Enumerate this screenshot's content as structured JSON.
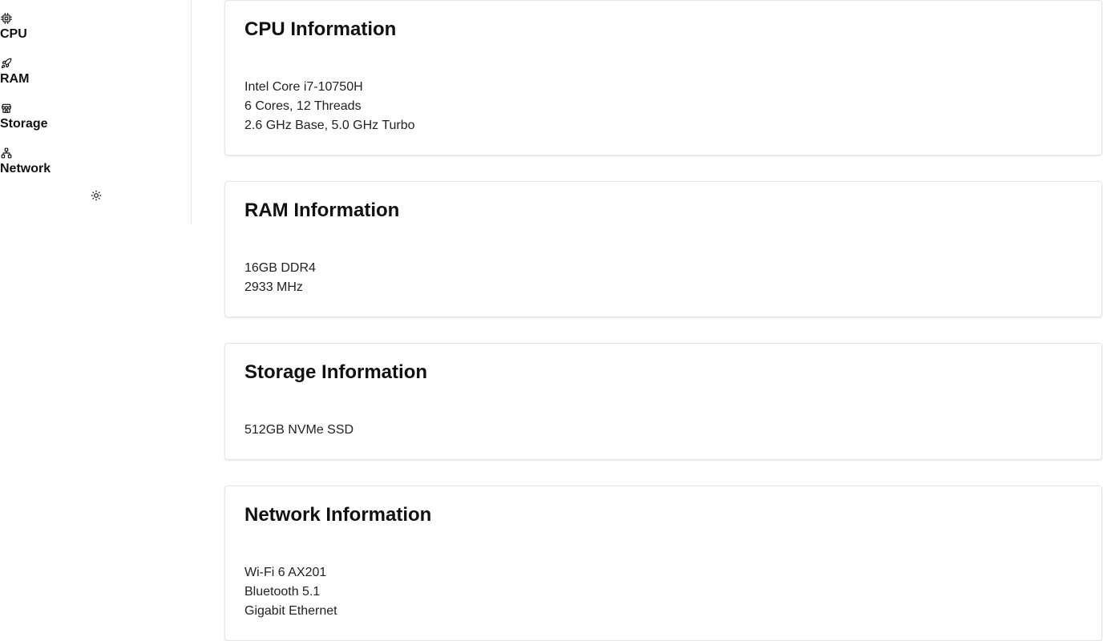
{
  "sidebar": {
    "items": [
      {
        "label": "CPU",
        "icon": "cpu-icon"
      },
      {
        "label": "RAM",
        "icon": "rocket-icon"
      },
      {
        "label": "Storage",
        "icon": "store-icon"
      },
      {
        "label": "Network",
        "icon": "network-icon"
      }
    ],
    "theme_toggle_icon": "sun-icon"
  },
  "cards": [
    {
      "title": "CPU Information",
      "lines": [
        "Intel Core i7-10750H",
        "6 Cores, 12 Threads",
        "2.6 GHz Base, 5.0 GHz Turbo"
      ]
    },
    {
      "title": "RAM Information",
      "lines": [
        "16GB DDR4",
        "2933 MHz"
      ]
    },
    {
      "title": "Storage Information",
      "lines": [
        "512GB NVMe SSD"
      ]
    },
    {
      "title": "Network Information",
      "lines": [
        "Wi-Fi 6 AX201",
        "Bluetooth 5.1",
        "Gigabit Ethernet"
      ]
    }
  ]
}
